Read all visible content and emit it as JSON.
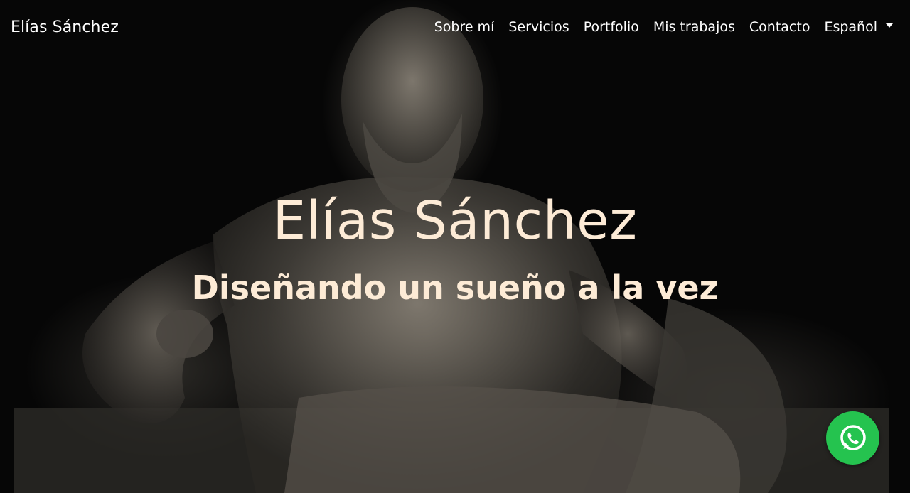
{
  "navbar": {
    "brand": "Elías Sánchez",
    "links": [
      {
        "label": "Sobre mí"
      },
      {
        "label": "Servicios"
      },
      {
        "label": "Portfolio"
      },
      {
        "label": "Mis trabajos"
      },
      {
        "label": "Contacto"
      }
    ],
    "language": {
      "selected": "Español",
      "icon": "caret-down-icon"
    }
  },
  "hero": {
    "title": "Elías Sánchez",
    "subtitle": "Diseñando un sueño a la vez",
    "background": "marble-statue-photo",
    "text_color": "#fdebd6"
  },
  "floating": {
    "whatsapp": {
      "icon": "whatsapp-icon",
      "color": "#25c34f"
    }
  }
}
